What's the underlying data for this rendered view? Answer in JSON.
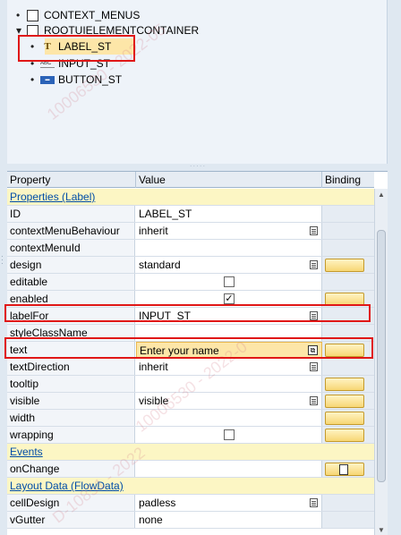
{
  "tree": {
    "items": [
      {
        "label": "CONTEXT_MENUS",
        "icon": "checkbox-icon"
      },
      {
        "label": "ROOTUIELEMENTCONTAINER",
        "icon": "checkbox-icon"
      },
      {
        "label": "LABEL_ST",
        "icon": "label-icon"
      },
      {
        "label": "INPUT_ST",
        "icon": "input-icon",
        "icon_text": "ABC"
      },
      {
        "label": "BUTTON_ST",
        "icon": "button-icon"
      }
    ]
  },
  "grid": {
    "headers": {
      "property": "Property",
      "value": "Value",
      "binding": "Binding"
    },
    "rows": [
      {
        "type": "section",
        "property": "Properties (Label)"
      },
      {
        "property": "ID",
        "value": "LABEL_ST"
      },
      {
        "property": "contextMenuBehaviour",
        "value": "inherit",
        "icon": "list-icon"
      },
      {
        "property": "contextMenuId",
        "value": ""
      },
      {
        "property": "design",
        "value": "standard",
        "icon": "list-icon",
        "binding_button": true
      },
      {
        "property": "editable",
        "value": "",
        "checkbox": false
      },
      {
        "property": "enabled",
        "value": "",
        "checkbox": true,
        "binding_button": true
      },
      {
        "property": "labelFor",
        "value": "INPUT_ST",
        "icon": "list-icon"
      },
      {
        "property": "styleClassName",
        "value": ""
      },
      {
        "property": "text",
        "value": "Enter your name",
        "icon": "popup-icon",
        "binding_button": true
      },
      {
        "property": "textDirection",
        "value": "inherit",
        "icon": "list-icon"
      },
      {
        "property": "tooltip",
        "value": "",
        "binding_button": true
      },
      {
        "property": "visible",
        "value": "visible",
        "icon": "list-icon",
        "binding_button": true
      },
      {
        "property": "width",
        "value": "",
        "binding_button": true
      },
      {
        "property": "wrapping",
        "value": "",
        "checkbox": false,
        "binding_button": true
      },
      {
        "type": "section",
        "property": "Events"
      },
      {
        "property": "onChange",
        "value": "",
        "binding_doc": true
      },
      {
        "type": "section",
        "property": "Layout Data (FlowData)"
      },
      {
        "property": "cellDesign",
        "value": "padless",
        "icon": "list-icon"
      },
      {
        "property": "vGutter",
        "value": "none"
      }
    ]
  },
  "watermark": {
    "texts": [
      "10006530 - 2022-05",
      "10006530 - 2022-0",
      "D-10851 - 2022"
    ]
  },
  "colors": {
    "section_bg": "#fcf6c4",
    "section_text": "#004da8",
    "highlight": "#e01717",
    "selected_bg": "#fde6a8"
  }
}
